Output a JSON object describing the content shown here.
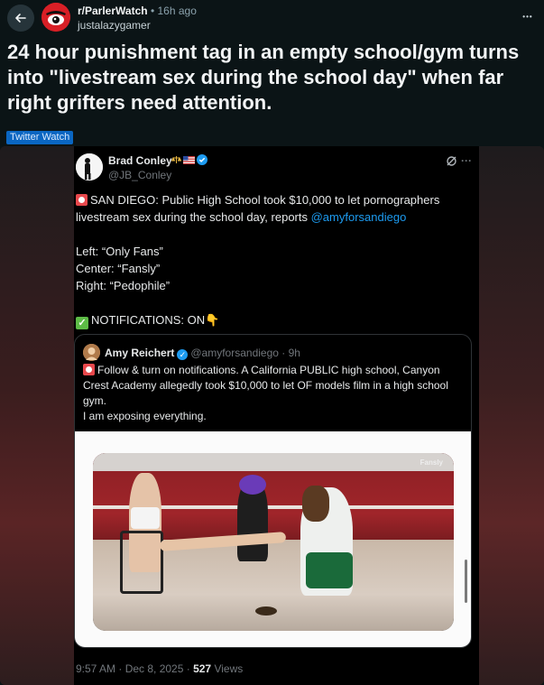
{
  "post": {
    "subreddit": "r/ParlerWatch",
    "separator": "•",
    "time_ago": "16h ago",
    "author": "justalazygamer",
    "more_label": "•••",
    "title": "24 hour punishment tag in an empty school/gym turns into \"livestream sex during the school day\" when far right grifters need attention.",
    "flair": "Twitter Watch"
  },
  "tweet": {
    "display_name": "Brad Conley",
    "handle": "@JB_Conley",
    "more_label": "···",
    "line1": "SAN DIEGO: Public High School took $10,000 to let pornographers livestream sex during the school day, reports ",
    "mention": "@amyforsandiego",
    "line_left": "Left: “Only Fans”",
    "line_center": "Center: “Fansly”",
    "line_right": "Right: “Pedophile”",
    "notifications": "NOTIFICATIONS: ON",
    "check_glyph": "✓",
    "point_glyph": "👇",
    "timestamp": "9:57 AM · Dec 8, 2025 · ",
    "views_count": "527",
    "views_label": " Views"
  },
  "quote": {
    "name": "Amy Reichert",
    "meta": "@amyforsandiego · 9h",
    "verified_glyph": "✓",
    "body1": "Follow & turn on notifications. A California PUBLIC high school, Canyon Crest Academy allegedly took $10,000 to let OF models film in a high school gym.",
    "body2": "I am exposing everything.",
    "watermark": "Fansly"
  },
  "icons": {
    "back": "arrow-left-icon",
    "subreddit_avatar": "subreddit-avatar",
    "verified": "verified-badge-icon",
    "grok": "grok-icon",
    "more": "more-icon"
  },
  "colors": {
    "background": "#0b1416",
    "flair_bg": "#0a66c2",
    "mention": "#1d9bf0",
    "tweet_bg": "#000000"
  }
}
